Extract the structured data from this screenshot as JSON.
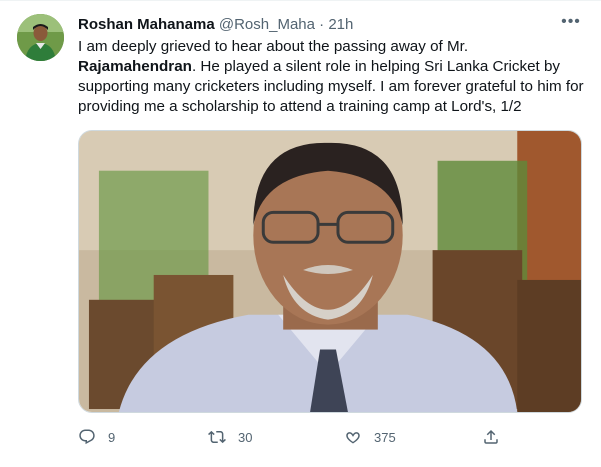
{
  "tweet": {
    "author_name": "Roshan Mahanama",
    "author_handle": "@Rosh_Maha",
    "separator": "·",
    "timestamp": "21h",
    "more_label": "•••",
    "text_part1": "I am deeply grieved to hear about the passing away of Mr. ",
    "text_bold": "Rajamahendran",
    "text_part2": ". He played a silent role in helping Sri Lanka Cricket by supporting many cricketers including myself. I am forever grateful to him for providing me a scholarship to attend a training camp at Lord's, 1/2",
    "media_icon": "photo-portrait"
  },
  "actions": {
    "reply_count": "9",
    "retweet_count": "30",
    "like_count": "375",
    "reply_icon": "reply-icon",
    "retweet_icon": "retweet-icon",
    "like_icon": "heart-icon",
    "share_icon": "share-icon"
  },
  "colors": {
    "text_primary": "#0f1419",
    "text_secondary": "#536471",
    "border": "#cfd9de"
  }
}
